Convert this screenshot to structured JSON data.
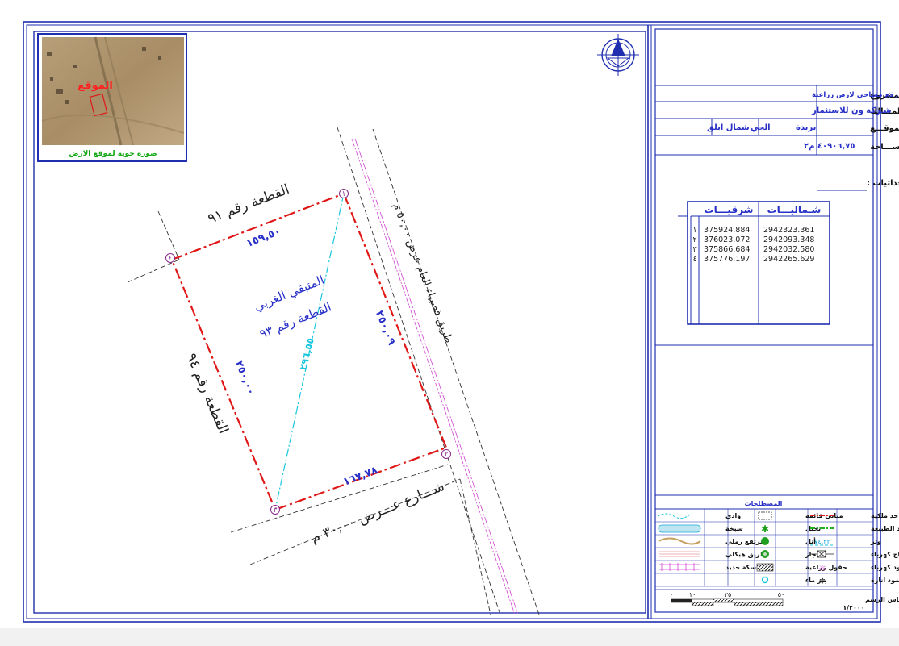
{
  "inset": {
    "site_label": "الموقع",
    "caption": "صورة جوية لموقع الارض"
  },
  "title_block": {
    "project_label": "اسم المشروع",
    "project_value": "رفع مساحي لارض زراعية",
    "owner_label": "المـــالك",
    "owner_value": "شـركة ون للاستثمار",
    "location_label": "الموقـــع",
    "location_city": "بريدة",
    "district_label": "الحي",
    "district_value": "شمال ابلق",
    "area_label": "المســـاحة",
    "area_value": "٤٠٩٠٦,٧٥ م٢",
    "coords_label": "الاحداثيات  :"
  },
  "coords_table": {
    "north_header": "شـماليـــات",
    "east_header": "شرقيـــات",
    "rows": [
      {
        "num": "١",
        "east": "375924.884",
        "north": "2942323.361"
      },
      {
        "num": "٢",
        "east": "376023.072",
        "north": "2942093.348"
      },
      {
        "num": "٣",
        "east": "375866.684",
        "north": "2942032.580"
      },
      {
        "num": "٤",
        "east": "375776.197",
        "north": "2942265.629"
      }
    ]
  },
  "legend": {
    "title": "المصطلحات",
    "items": {
      "property_boundary": "حد ملكية",
      "existing_buildings": "مباني قائمة",
      "wadi": "وادي",
      "natural_boundary": "حد الطبيعة",
      "palms": "نخيل",
      "sabkha": "سبخة",
      "chord": "وتر",
      "chord_value": "٧٤,٣٢",
      "athl": "أثل",
      "sand_dune": "مرتفع رملي",
      "power_towers": "ابراج كهرباء",
      "trees": "أشـجار",
      "skeleton_road": "طريق هيكلي",
      "power_pole": "عمود كهرباء",
      "farm_fields": "حقول زراعية",
      "railway": "سكة حديد",
      "light_pole": "عمود انارة",
      "water_well": "بئر ماء"
    }
  },
  "scale": {
    "label": "مقياس الرسم",
    "ratio": "١/٢٠٠٠",
    "ticks": [
      "٠",
      "١٠",
      "٢٥",
      "٥٠"
    ]
  },
  "plan": {
    "north_neighbor": "القطعة رقم  ٩١",
    "west_neighbor": "القطعة رقم  ٩٤",
    "east_road": "طريق قصيباء العام عرض ٥٠,٠٠ م",
    "south_street": "شـــارع عـــرض  ٣٠,٠٠ م",
    "parcel_line1": "المتبقي الغربي",
    "parcel_line2": "القطعة رقم  ٩٣",
    "len_north": "١٥٩,٥٠",
    "len_east": "٢٥٠,٠٩",
    "len_south": "١٦٧,٧٨",
    "len_west": "٢٥٠,٠٠",
    "len_diag": "٢٩٦,٥٥",
    "corners": [
      "١",
      "٢",
      "٣",
      "٤"
    ]
  },
  "colors": {
    "frame": "#1f2fb0",
    "boundary": "#e01818",
    "dimension": "#2830c8",
    "diagonal": "#19c6de",
    "road_center": "#d040d0"
  }
}
